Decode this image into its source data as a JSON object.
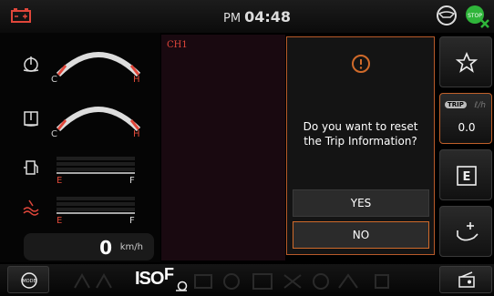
{
  "header": {
    "ampm": "PM",
    "time": "04:48",
    "icons": [
      "battery-icon",
      "steering-icon",
      "stop-icon"
    ],
    "colors": {
      "warning": "#e0463a",
      "stop": "#2fb53a"
    }
  },
  "gauges": [
    {
      "name": "engine-oil",
      "icon": "oil-temp-icon",
      "min_label": "C",
      "max_label": "H"
    },
    {
      "name": "hydraulic-oil",
      "icon": "hydraulic-temp-icon",
      "min_label": "C",
      "max_label": "H"
    }
  ],
  "bars": [
    {
      "name": "fuel",
      "icon": "fuel-icon",
      "min_label": "E",
      "max_label": "F"
    },
    {
      "name": "def",
      "icon": "def-fluid-icon",
      "min_label": "E",
      "max_label": "F"
    }
  ],
  "speed": {
    "value": "0",
    "unit": "km/h"
  },
  "channel": {
    "label": "CH1"
  },
  "dialog": {
    "message": "Do you want to reset\nthe Trip Information?",
    "yes_label": "YES",
    "no_label": "NO",
    "icon": "warning-icon"
  },
  "rail": {
    "favorite_icon": "star-icon",
    "trip_badge": "TRIP",
    "trip_unit": "ℓ/h",
    "trip_value": "0.0",
    "eco_label": "E",
    "bucket_icon": "bucket-add-icon"
  },
  "bottom": {
    "iso_label": "ISO",
    "f_label": "F",
    "left_icon": "engine-mode-icon",
    "right_icon": "radio-icon"
  }
}
